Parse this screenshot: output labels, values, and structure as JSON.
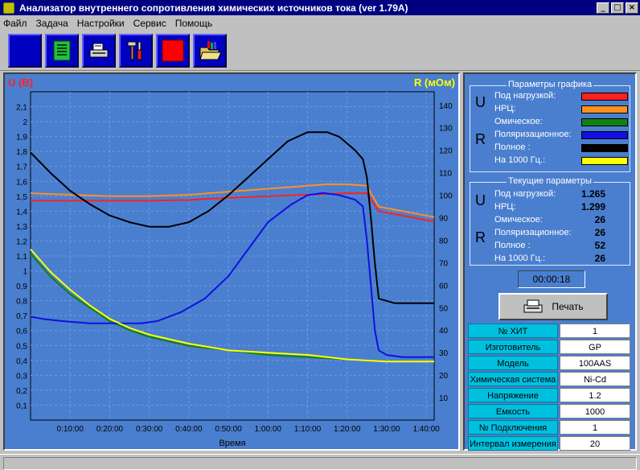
{
  "window": {
    "title": "Анализатор внутреннего сопротивления химических источников тока (ver 1.79A)",
    "min_glyph": "_",
    "max_glyph": "□",
    "close_glyph": "×"
  },
  "menu": [
    "Файл",
    "Задача",
    "Настройки",
    "Сервис",
    "Помощь"
  ],
  "toolbar": {
    "icons": [
      "blank-tool-icon",
      "board-icon",
      "printer-settings-icon",
      "tools-icon",
      "stop-icon",
      "open-folder-icon"
    ]
  },
  "chart": {
    "left_axis_title": "U (В)",
    "right_axis_title": "R (мОм)",
    "x_axis_title": "Время"
  },
  "chart_data": {
    "type": "line",
    "x_unit": "minutes",
    "x_ticks": [
      "0:10:00",
      "0:20:00",
      "0:30:00",
      "0:40:00",
      "0:50:00",
      "1:00:00",
      "1:10:00",
      "1:20:00",
      "1:30:00",
      "1:40:00"
    ],
    "y_left_ticks": [
      "0,1",
      "0,2",
      "0,3",
      "0,4",
      "0,5",
      "0,6",
      "0,7",
      "0,8",
      "0,9",
      "1",
      "1,1",
      "1,2",
      "1,3",
      "1,4",
      "1,5",
      "1,6",
      "1,7",
      "1,8",
      "1,9",
      "2",
      "2,1"
    ],
    "y_right_ticks": [
      "10",
      "20",
      "30",
      "40",
      "50",
      "60",
      "70",
      "80",
      "90",
      "100",
      "110",
      "120",
      "130",
      "140"
    ],
    "ylim_left": [
      0,
      2.2
    ],
    "ylim_right": [
      0,
      146
    ],
    "xlim": [
      0,
      102
    ],
    "grid": true,
    "series": [
      {
        "name": "Под нагрузкой",
        "axis": "left",
        "color": "#ff2020",
        "x": [
          0,
          10,
          20,
          30,
          40,
          50,
          60,
          70,
          80,
          85,
          86,
          88,
          92,
          96,
          100,
          102
        ],
        "y": [
          1.47,
          1.47,
          1.47,
          1.47,
          1.475,
          1.49,
          1.5,
          1.51,
          1.52,
          1.52,
          1.48,
          1.4,
          1.38,
          1.36,
          1.34,
          1.33
        ]
      },
      {
        "name": "НРЦ",
        "axis": "left",
        "color": "#ff9020",
        "x": [
          0,
          10,
          20,
          30,
          40,
          50,
          60,
          70,
          75,
          80,
          85,
          86,
          88,
          92,
          96,
          100,
          102
        ],
        "y": [
          1.52,
          1.51,
          1.5,
          1.5,
          1.51,
          1.53,
          1.55,
          1.57,
          1.58,
          1.58,
          1.57,
          1.52,
          1.43,
          1.41,
          1.39,
          1.37,
          1.36
        ]
      },
      {
        "name": "Омическое",
        "axis": "right",
        "color": "#108010",
        "x": [
          0,
          5,
          10,
          15,
          20,
          25,
          30,
          40,
          50,
          60,
          70,
          80,
          90,
          100,
          102
        ],
        "y": [
          74,
          64,
          56,
          50,
          44,
          40,
          37,
          33,
          31,
          29,
          28,
          27,
          26,
          26,
          26
        ]
      },
      {
        "name": "Поляризационное",
        "axis": "right",
        "color": "#1010e0",
        "x": [
          0,
          3,
          8,
          15,
          22,
          28,
          32,
          38,
          44,
          50,
          55,
          60,
          66,
          70,
          74,
          78,
          82,
          84,
          85,
          86,
          87,
          88,
          90,
          94,
          100,
          102
        ],
        "y": [
          46,
          45,
          44,
          43,
          43,
          43,
          44,
          48,
          54,
          64,
          76,
          88,
          96,
          100,
          101,
          100,
          98,
          95,
          80,
          60,
          40,
          31,
          29,
          28,
          28,
          28
        ]
      },
      {
        "name": "Полное",
        "axis": "right",
        "color": "#000000",
        "x": [
          0,
          5,
          10,
          15,
          20,
          25,
          30,
          35,
          40,
          45,
          50,
          55,
          60,
          65,
          70,
          75,
          78,
          80,
          82,
          84,
          85,
          86,
          87,
          88,
          92,
          96,
          100,
          102
        ],
        "y": [
          119,
          110,
          102,
          96,
          91,
          88,
          86,
          86,
          88,
          93,
          100,
          108,
          116,
          124,
          128,
          128,
          126,
          123,
          120,
          116,
          108,
          90,
          70,
          54,
          52,
          52,
          52,
          52
        ]
      },
      {
        "name": "На 1000 Гц.",
        "axis": "right",
        "color": "#ffff00",
        "x": [
          0,
          5,
          10,
          15,
          20,
          25,
          30,
          40,
          50,
          60,
          70,
          80,
          90,
          100,
          102
        ],
        "y": [
          76,
          66,
          58,
          51,
          45,
          41,
          38,
          34,
          31,
          30,
          29,
          27,
          26,
          26,
          26
        ]
      }
    ]
  },
  "params_graph": {
    "title": "Параметры графика",
    "u_letter": "U",
    "r_letter": "R",
    "rows": [
      {
        "label": "Под нагрузкой:",
        "color": "#ff2020"
      },
      {
        "label": "НРЦ:",
        "color": "#ff9020"
      },
      {
        "label": "Омическое:",
        "color": "#108010"
      },
      {
        "label": "Поляризационное:",
        "color": "#1010e0"
      },
      {
        "label": "Полное :",
        "color": "#000000"
      },
      {
        "label": "На 1000 Гц.:",
        "color": "#ffff00"
      }
    ]
  },
  "current_params": {
    "title": "Текущие параметры",
    "u_letter": "U",
    "r_letter": "R",
    "rows": [
      {
        "label": "Под нагрузкой:",
        "value": "1.265"
      },
      {
        "label": "НРЦ:",
        "value": "1.299"
      },
      {
        "label": "Омическое:",
        "value": "26"
      },
      {
        "label": "Поляризационное:",
        "value": "26"
      },
      {
        "label": "Полное :",
        "value": "52"
      },
      {
        "label": "На 1000 Гц.:",
        "value": "26"
      }
    ]
  },
  "timer": "00:00:18",
  "print_label": "Печать",
  "info": [
    {
      "label": "№ ХИТ",
      "value": "1"
    },
    {
      "label": "Изготовитель",
      "value": "GP"
    },
    {
      "label": "Модель",
      "value": "100AAS"
    },
    {
      "label": "Химическая система",
      "value": "Ni-Cd"
    },
    {
      "label": "Напряжение",
      "value": "1.2"
    },
    {
      "label": "Емкость",
      "value": "1000"
    },
    {
      "label": "№ Подключения",
      "value": "1"
    },
    {
      "label": "Интервал измерения",
      "value": "20"
    }
  ]
}
